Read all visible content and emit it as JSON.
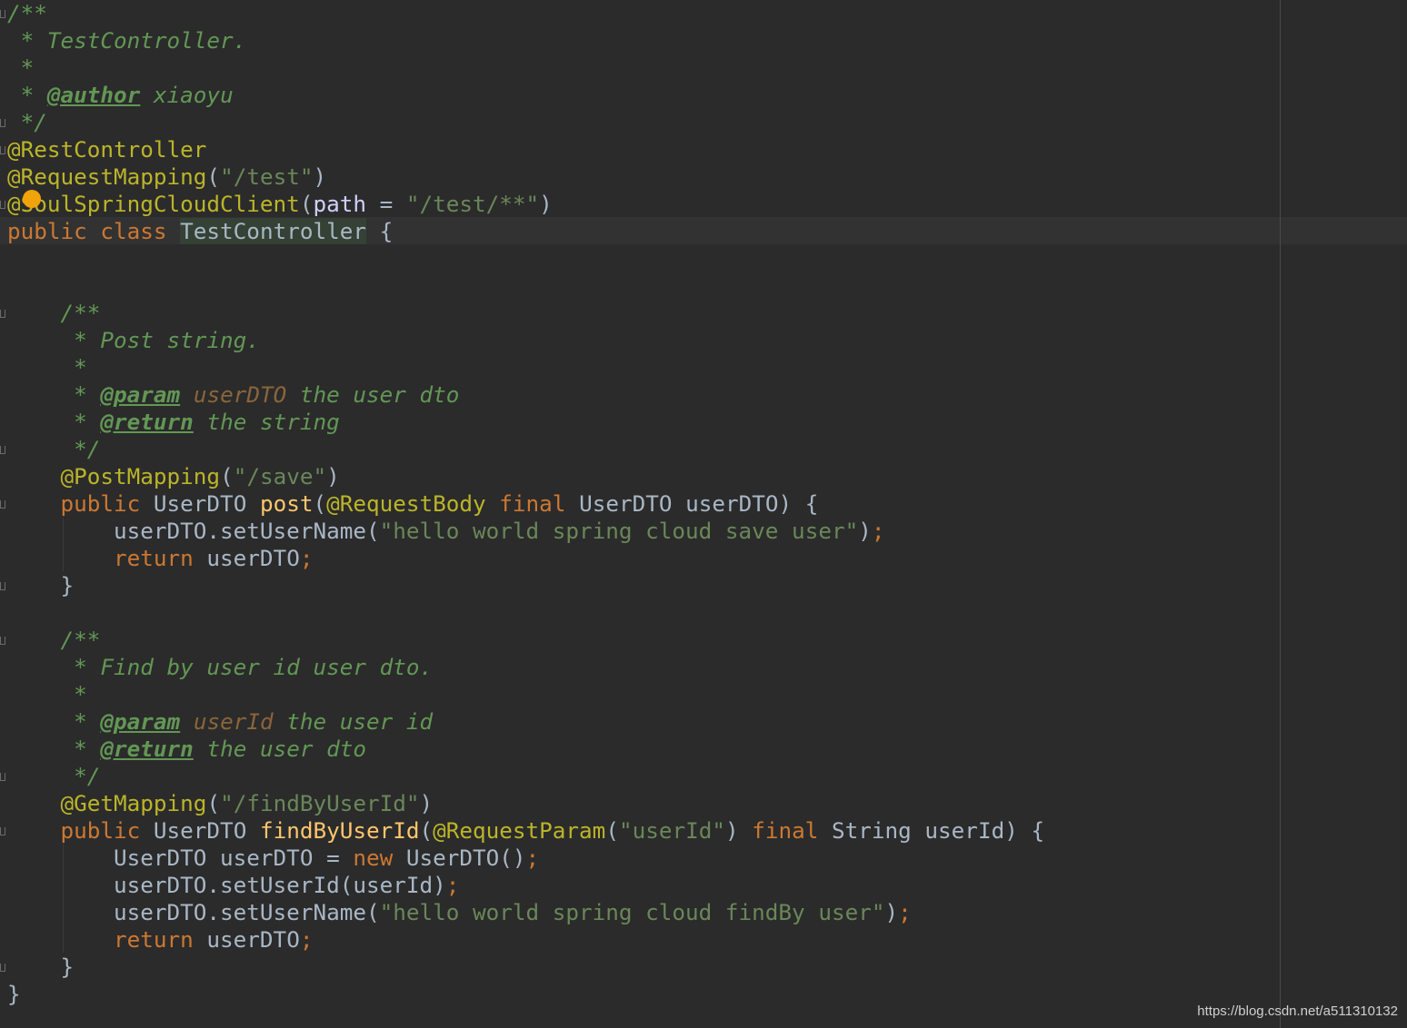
{
  "editor": {
    "file_class": "TestController",
    "watermark": "https://blog.csdn.net/a511310132",
    "intention_icon": "lightbulb-icon"
  },
  "lines": [
    [
      [
        "t-doc",
        "/**"
      ]
    ],
    [
      [
        "t-doc",
        " * TestController."
      ]
    ],
    [
      [
        "t-doc",
        " *"
      ]
    ],
    [
      [
        "t-doc",
        " * "
      ],
      [
        "t-tag",
        "@author"
      ],
      [
        "t-doc",
        " xiaoyu"
      ]
    ],
    [
      [
        "t-doc",
        " */"
      ]
    ],
    [
      [
        "t-ann",
        "@RestController"
      ]
    ],
    [
      [
        "t-ann",
        "@RequestMapping"
      ],
      [
        "t-id",
        "("
      ],
      [
        "t-str",
        "\"/test\""
      ],
      [
        "t-id",
        ")"
      ]
    ],
    [
      [
        "t-ann",
        "@SoulSpringCloudClient"
      ],
      [
        "t-id",
        "("
      ],
      [
        "t-attr",
        "path"
      ],
      [
        "t-id",
        " = "
      ],
      [
        "t-str",
        "\"/test/**\""
      ],
      [
        "t-id",
        ")"
      ]
    ],
    [
      [
        "t-kw",
        "public class "
      ],
      [
        "t-cls-hl",
        "TestController"
      ],
      [
        "t-id",
        " {"
      ]
    ],
    [],
    [],
    [
      [
        "t-doc",
        "    /**"
      ]
    ],
    [
      [
        "t-doc",
        "     * Post string."
      ]
    ],
    [
      [
        "t-doc",
        "     *"
      ]
    ],
    [
      [
        "t-doc",
        "     * "
      ],
      [
        "t-tag",
        "@param"
      ],
      [
        "t-doc",
        " "
      ],
      [
        "t-param",
        "userDTO"
      ],
      [
        "t-doc",
        " the user dto"
      ]
    ],
    [
      [
        "t-doc",
        "     * "
      ],
      [
        "t-tag",
        "@return"
      ],
      [
        "t-doc",
        " the string"
      ]
    ],
    [
      [
        "t-doc",
        "     */"
      ]
    ],
    [
      [
        "t-id",
        "    "
      ],
      [
        "t-ann",
        "@PostMapping"
      ],
      [
        "t-id",
        "("
      ],
      [
        "t-str",
        "\"/save\""
      ],
      [
        "t-id",
        ")"
      ]
    ],
    [
      [
        "t-kw",
        "    public "
      ],
      [
        "t-id",
        "UserDTO "
      ],
      [
        "t-fn",
        "post"
      ],
      [
        "t-id",
        "("
      ],
      [
        "t-ann",
        "@RequestBody"
      ],
      [
        "t-kw",
        " final "
      ],
      [
        "t-id",
        "UserDTO userDTO) {"
      ]
    ],
    [
      [
        "t-id",
        "        userDTO.setUserName("
      ],
      [
        "t-str",
        "\"hello world spring cloud save user\""
      ],
      [
        "t-id",
        ")"
      ],
      [
        "t-kw",
        ";"
      ]
    ],
    [
      [
        "t-kw",
        "        return "
      ],
      [
        "t-id",
        "userDTO"
      ],
      [
        "t-kw",
        ";"
      ]
    ],
    [
      [
        "t-id",
        "    }"
      ]
    ],
    [],
    [
      [
        "t-doc",
        "    /**"
      ]
    ],
    [
      [
        "t-doc",
        "     * Find by user id user dto."
      ]
    ],
    [
      [
        "t-doc",
        "     *"
      ]
    ],
    [
      [
        "t-doc",
        "     * "
      ],
      [
        "t-tag",
        "@param"
      ],
      [
        "t-doc",
        " "
      ],
      [
        "t-param",
        "userId"
      ],
      [
        "t-doc",
        " the user id"
      ]
    ],
    [
      [
        "t-doc",
        "     * "
      ],
      [
        "t-tag",
        "@return"
      ],
      [
        "t-doc",
        " the user dto"
      ]
    ],
    [
      [
        "t-doc",
        "     */"
      ]
    ],
    [
      [
        "t-id",
        "    "
      ],
      [
        "t-ann",
        "@GetMapping"
      ],
      [
        "t-id",
        "("
      ],
      [
        "t-str",
        "\"/findByUserId\""
      ],
      [
        "t-id",
        ")"
      ]
    ],
    [
      [
        "t-kw",
        "    public "
      ],
      [
        "t-id",
        "UserDTO "
      ],
      [
        "t-fn",
        "findByUserId"
      ],
      [
        "t-id",
        "("
      ],
      [
        "t-ann",
        "@RequestParam"
      ],
      [
        "t-id",
        "("
      ],
      [
        "t-str",
        "\"userId\""
      ],
      [
        "t-id",
        ")"
      ],
      [
        "t-kw",
        " final "
      ],
      [
        "t-id",
        "String userId) {"
      ]
    ],
    [
      [
        "t-id",
        "        UserDTO userDTO = "
      ],
      [
        "t-kw",
        "new "
      ],
      [
        "t-id",
        "UserDTO()"
      ],
      [
        "t-kw",
        ";"
      ]
    ],
    [
      [
        "t-id",
        "        userDTO.setUserId(userId)"
      ],
      [
        "t-kw",
        ";"
      ]
    ],
    [
      [
        "t-id",
        "        userDTO.setUserName("
      ],
      [
        "t-str",
        "\"hello world spring cloud findBy user\""
      ],
      [
        "t-id",
        ")"
      ],
      [
        "t-kw",
        ";"
      ]
    ],
    [
      [
        "t-kw",
        "        return "
      ],
      [
        "t-id",
        "userDTO"
      ],
      [
        "t-kw",
        ";"
      ]
    ],
    [
      [
        "t-id",
        "    }"
      ]
    ],
    [
      [
        "t-id",
        "}"
      ]
    ]
  ],
  "folds": [
    0,
    4,
    5,
    7,
    11,
    16,
    18,
    21,
    23,
    28,
    30,
    35
  ]
}
